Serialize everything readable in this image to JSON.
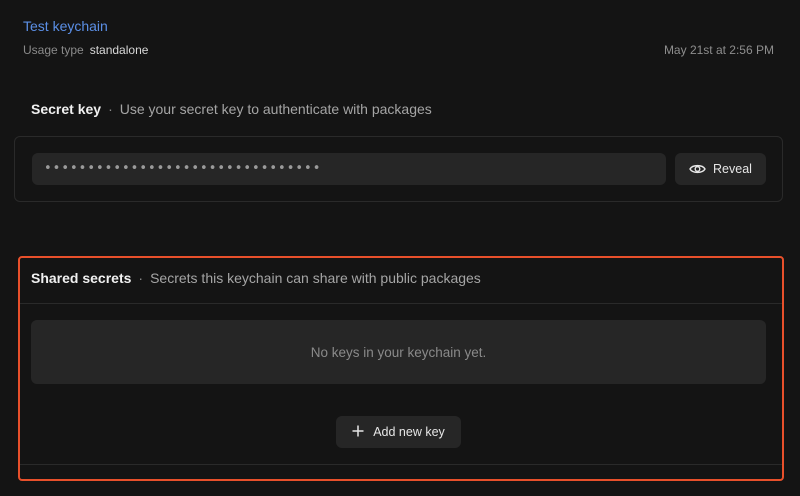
{
  "header": {
    "title": "Test keychain",
    "usage_label": "Usage type",
    "usage_value": "standalone",
    "date": "May 21st at 2:56 PM"
  },
  "secret_key": {
    "heading": "Secret key",
    "separator": "·",
    "description": "Use your secret key to authenticate with packages",
    "masked_value": "••••••••••••••••••••••••••••••••",
    "reveal_label": "Reveal"
  },
  "shared_secrets": {
    "heading": "Shared secrets",
    "separator": "·",
    "description": "Secrets this keychain can share with public packages",
    "empty_text": "No keys in your keychain yet.",
    "add_label": "Add new key"
  },
  "icons": {
    "reveal": "eye-icon",
    "add": "plus-icon"
  },
  "colors": {
    "accent_link": "#5b8fe6",
    "highlight_border": "#e8502b"
  }
}
